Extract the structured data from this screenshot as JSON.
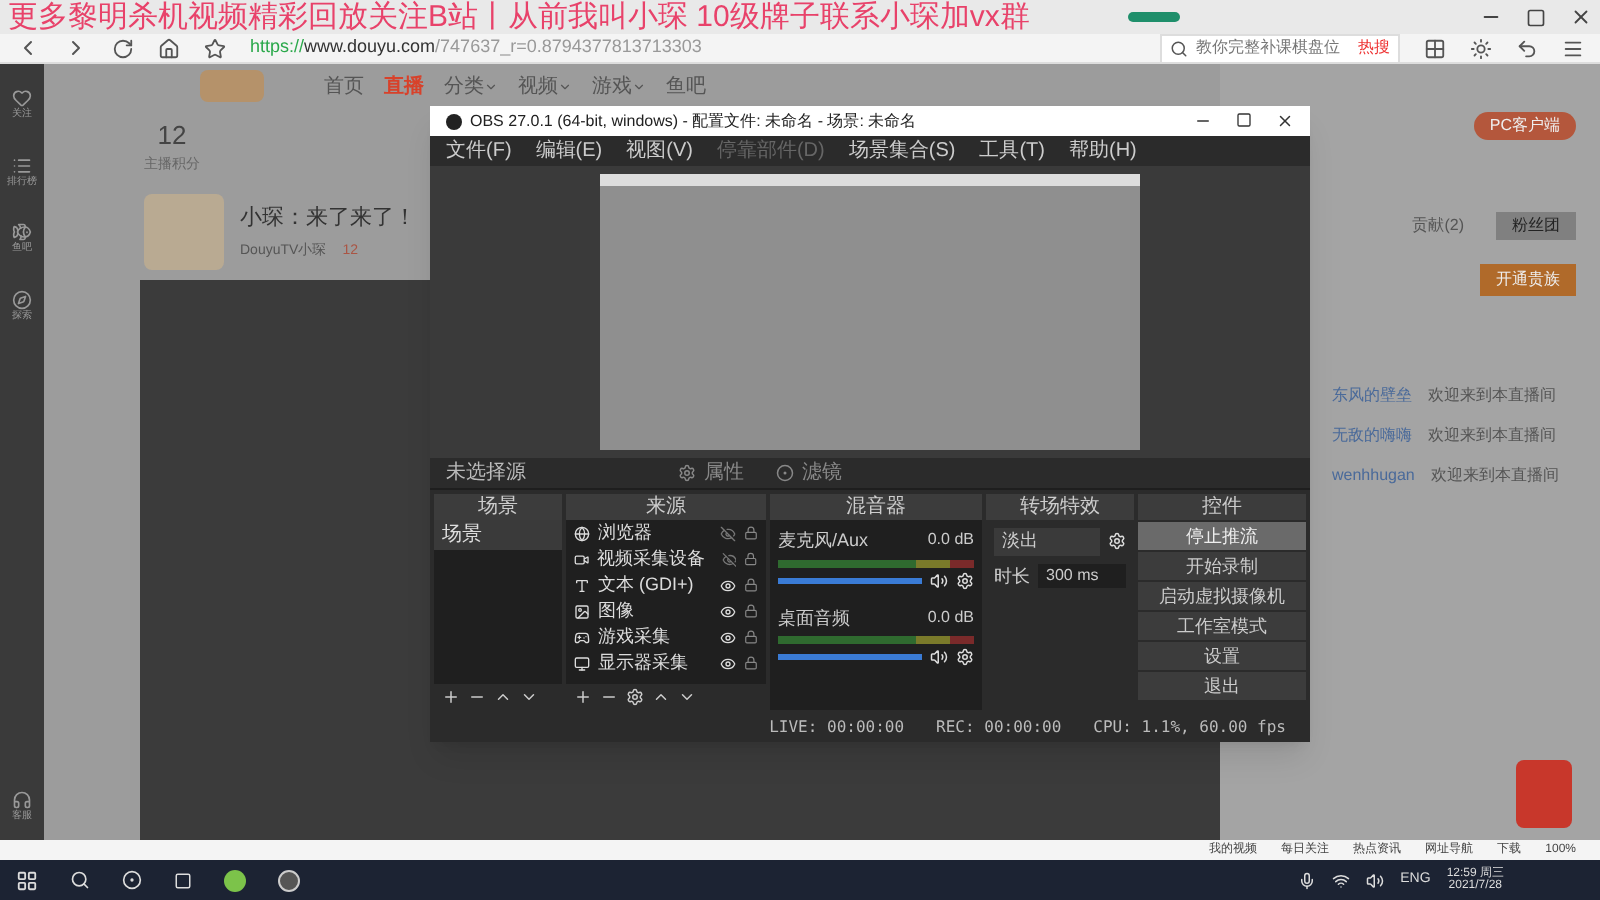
{
  "overlay_caption": "更多黎明杀机视频精彩回放关注B站丨从前我叫小琛 10级牌子联系小琛加vx群",
  "browser": {
    "url_scheme": "https://",
    "url_host": "www.douyu.com",
    "url_rest": "/747637_r=0.8794377813713303",
    "search_placeholder": "教你完整补课棋盘位",
    "search_hot": "热搜"
  },
  "sidebar": [
    {
      "label": "关注",
      "kind": "heart"
    },
    {
      "label": "排行榜",
      "kind": "list"
    },
    {
      "label": "鱼吧",
      "kind": "fish"
    },
    {
      "label": "探索",
      "kind": "compass"
    }
  ],
  "sidebar_bottom": {
    "label": "客服"
  },
  "site_nav": [
    {
      "label": "首页",
      "selected": false,
      "dropdown": false
    },
    {
      "label": "直播",
      "selected": true,
      "dropdown": false
    },
    {
      "label": "分类",
      "selected": false,
      "dropdown": true
    },
    {
      "label": "视频",
      "selected": false,
      "dropdown": true
    },
    {
      "label": "游戏",
      "selected": false,
      "dropdown": true
    },
    {
      "label": "鱼吧",
      "selected": false,
      "dropdown": false
    }
  ],
  "stats": {
    "value": "12",
    "label": "主播积分"
  },
  "streamer": {
    "title": "小琛：来了来了！",
    "channel": "DouyuTV小琛",
    "hot": "12"
  },
  "right_panel": {
    "client_button": "PC客户端",
    "noble_button": "开通贵族",
    "tabs": [
      {
        "label": "贡献(2)",
        "selected": false
      },
      {
        "label": "粉丝团",
        "selected": true
      }
    ],
    "messages": [
      {
        "user": "东风的壁垒",
        "text": "欢迎来到本直播间"
      },
      {
        "user": "无敌的嗨嗨",
        "text": "欢迎来到本直播间"
      },
      {
        "user": "wenhhugan",
        "text": "欢迎来到本直播间"
      }
    ]
  },
  "obs": {
    "title": "OBS 27.0.1 (64-bit, windows) - 配置文件: 未命名 - 场景: 未命名",
    "menu": [
      {
        "label": "文件(F)",
        "disabled": false
      },
      {
        "label": "编辑(E)",
        "disabled": false
      },
      {
        "label": "视图(V)",
        "disabled": false
      },
      {
        "label": "停靠部件(D)",
        "disabled": true
      },
      {
        "label": "场景集合(S)",
        "disabled": false
      },
      {
        "label": "工具(T)",
        "disabled": false
      },
      {
        "label": "帮助(H)",
        "disabled": false
      }
    ],
    "no_source": "未选择源",
    "properties": "属性",
    "filters": "滤镜",
    "docks": {
      "scenes": "场景",
      "sources": "来源",
      "mixer": "混音器",
      "transitions": "转场特效",
      "controls": "控件"
    },
    "scenes": [
      {
        "name": "场景",
        "selected": true
      }
    ],
    "sources": [
      {
        "name": "浏览器",
        "kind": "browser",
        "visible": false
      },
      {
        "name": "视频采集设备",
        "kind": "video",
        "visible": false
      },
      {
        "name": "文本 (GDI+)",
        "kind": "text",
        "visible": true
      },
      {
        "name": "图像",
        "kind": "image",
        "visible": true
      },
      {
        "name": "游戏采集",
        "kind": "game",
        "visible": true
      },
      {
        "name": "显示器采集",
        "kind": "display",
        "visible": true
      }
    ],
    "mixer": [
      {
        "name": "麦克风/Aux",
        "db": "0.0 dB",
        "level": 1
      },
      {
        "name": "桌面音频",
        "db": "0.0 dB",
        "level": 1
      }
    ],
    "transition": {
      "value": "淡出",
      "duration_label": "时长",
      "duration": "300 ms"
    },
    "controls": [
      {
        "label": "停止推流",
        "highlighted": true
      },
      {
        "label": "开始录制",
        "highlighted": false
      },
      {
        "label": "启动虚拟摄像机",
        "highlighted": false
      },
      {
        "label": "工作室模式",
        "highlighted": false
      },
      {
        "label": "设置",
        "highlighted": false
      },
      {
        "label": "退出",
        "highlighted": false
      }
    ],
    "status": {
      "live": "LIVE: 00:00:00",
      "rec": "REC: 00:00:00",
      "cpu": "CPU: 1.1%, 60.00 fps"
    }
  },
  "status_bar": [
    "我的视频",
    "每日关注",
    "热点资讯",
    "网址导航",
    "下载",
    "100%"
  ],
  "taskbar": {
    "lang": "ENG",
    "time": "12:59 周三",
    "date": "2021/7/28"
  }
}
